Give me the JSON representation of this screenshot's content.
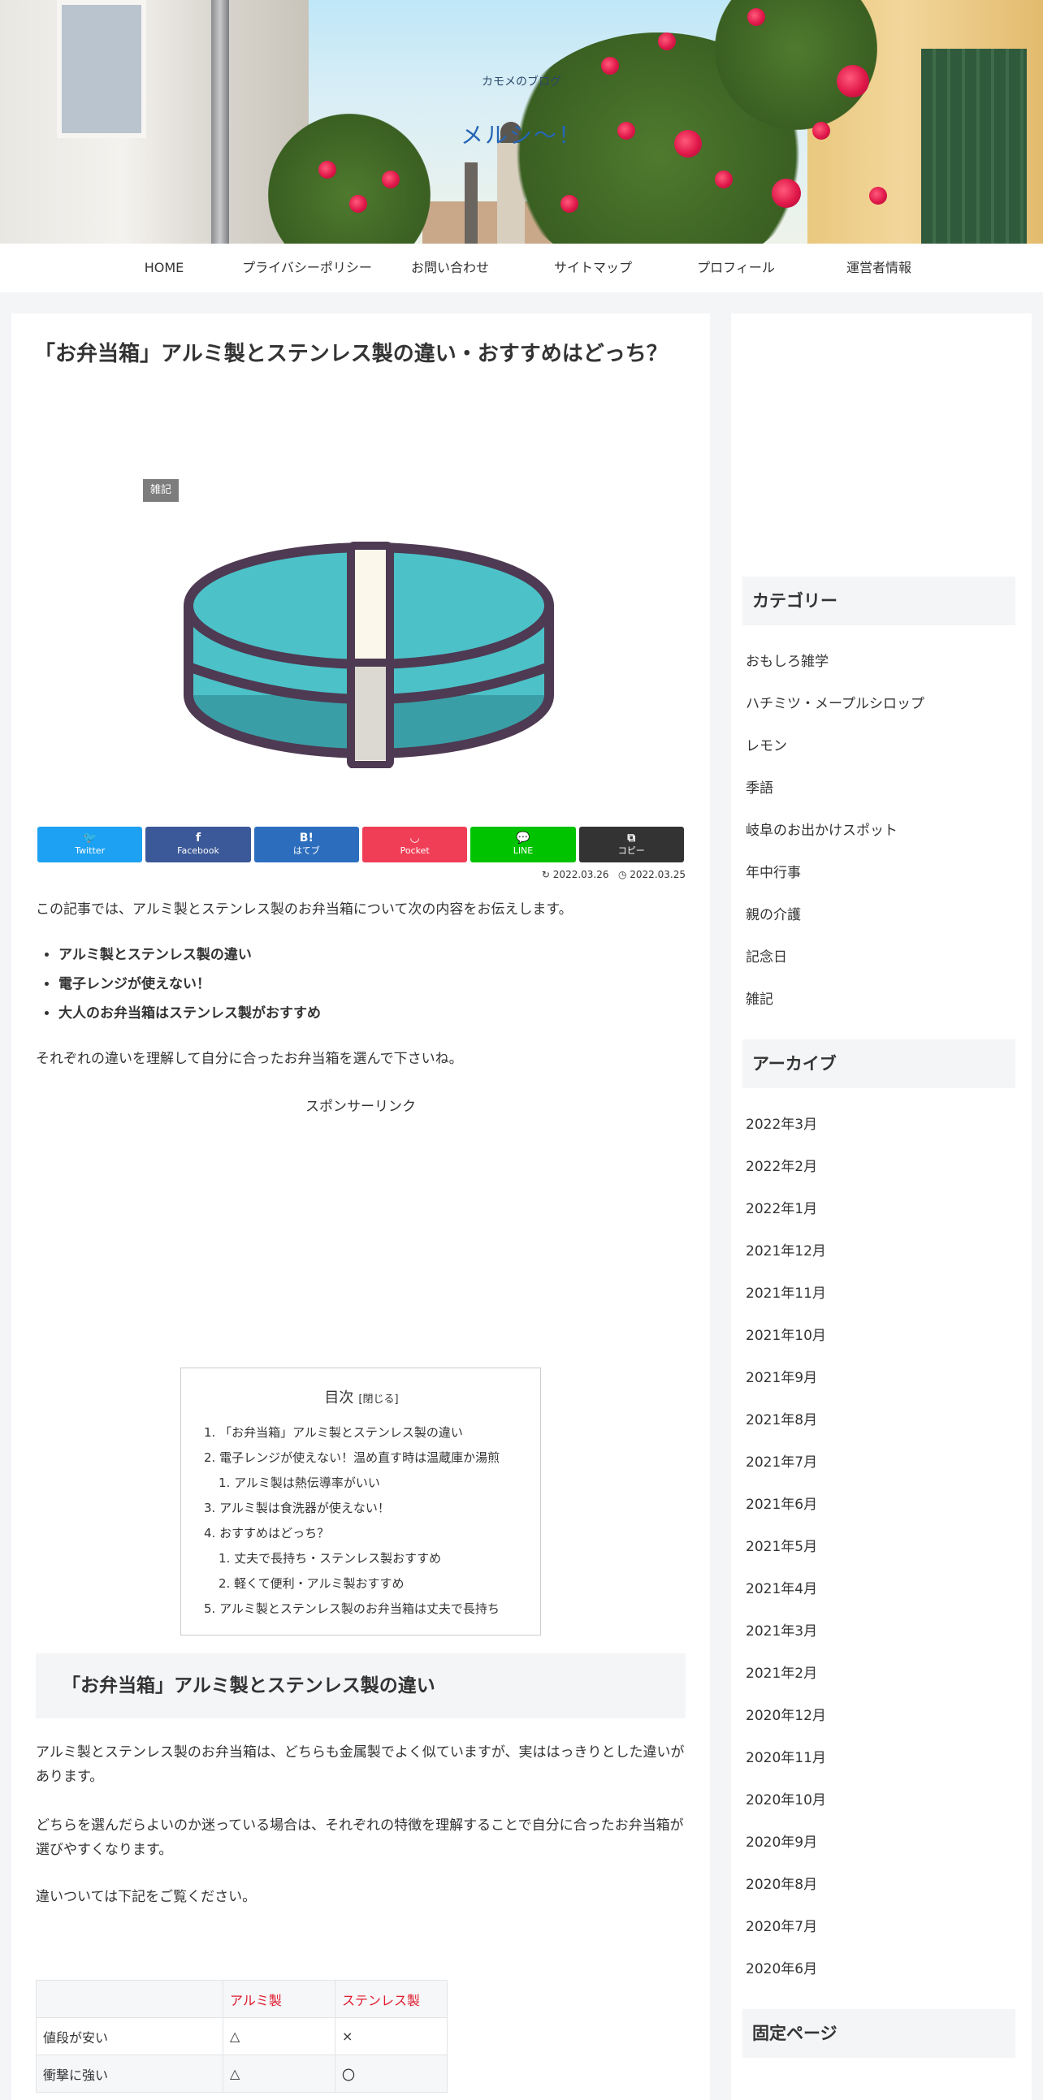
{
  "site": {
    "tagline": "カモメのブログ",
    "title": "メルシ～！"
  },
  "nav": [
    "HOME",
    "プライバシーポリシー",
    "お問い合わせ",
    "サイトマップ",
    "プロフィール",
    "運営者情報"
  ],
  "article": {
    "title": "「お弁当箱」アルミ製とステンレス製の違い・おすすめはどっち？",
    "category": "雑記",
    "share": [
      {
        "icon": "twitter-icon",
        "glyph": "🐦",
        "label": "Twitter",
        "color": "#1da1f2"
      },
      {
        "icon": "facebook-icon",
        "glyph": "f",
        "label": "Facebook",
        "color": "#3b5998"
      },
      {
        "icon": "hatena-icon",
        "glyph": "B!",
        "label": "はてブ",
        "color": "#2c6ebd"
      },
      {
        "icon": "pocket-icon",
        "glyph": "◡",
        "label": "Pocket",
        "color": "#ef3e56"
      },
      {
        "icon": "line-icon",
        "glyph": "💬",
        "label": "LINE",
        "color": "#00c300"
      },
      {
        "icon": "copy-icon",
        "glyph": "⧉",
        "label": "コピー",
        "color": "#333333"
      }
    ],
    "updated": "2022.03.26",
    "published": "2022.03.25",
    "intro": "この記事では、アルミ製とステンレス製のお弁当箱について次の内容をお伝えします。",
    "bullets": [
      "アルミ製とステンレス製の違い",
      "電子レンジが使えない！",
      "大人のお弁当箱はステンレス製がおすすめ"
    ],
    "lead": "それぞれの違いを理解して自分に合ったお弁当箱を選んで下さいね。",
    "sponsor": "スポンサーリンク",
    "toc": {
      "title": "目次",
      "toggle": "[閉じる]",
      "items": [
        "1. 「お弁当箱」アルミ製とステンレス製の違い",
        "2. 電子レンジが使えない！温め直す時は温蔵庫か湯煎",
        "1. アルミ製は熱伝導率がいい",
        "3. アルミ製は食洗器が使えない！",
        "4. おすすめはどっち？",
        "1. 丈夫で長持ち・ステンレス製おすすめ",
        "2. 軽くて便利・アルミ製おすすめ",
        "5. アルミ製とステンレス製のお弁当箱は丈夫で長持ち"
      ]
    },
    "h2": "「お弁当箱」アルミ製とステンレス製の違い",
    "p1": "アルミ製とステンレス製のお弁当箱は、どちらも金属製でよく似ていますが、実ははっきりとした違いがあります。",
    "p2": "どちらを選んだらよいのか迷っている場合は、それぞれの特徴を理解することで自分に合ったお弁当箱が選びやすくなります。",
    "p3": "違いついては下記をご覧ください。",
    "table": {
      "headers": [
        "",
        "アルミ製",
        "ステンレス製"
      ],
      "rows": [
        [
          "値段が安い",
          "△",
          "×"
        ],
        [
          "衝撃に強い",
          "△",
          "〇"
        ]
      ]
    }
  },
  "sidebar": {
    "categories_title": "カテゴリー",
    "categories": [
      "おもしろ雑学",
      "ハチミツ・メープルシロップ",
      "レモン",
      "季語",
      "岐阜のお出かけスポット",
      "年中行事",
      "親の介護",
      "記念日",
      "雑記"
    ],
    "archive_title": "アーカイブ",
    "archives": [
      "2022年3月",
      "2022年2月",
      "2022年1月",
      "2021年12月",
      "2021年11月",
      "2021年10月",
      "2021年9月",
      "2021年8月",
      "2021年7月",
      "2021年6月",
      "2021年5月",
      "2021年4月",
      "2021年3月",
      "2021年2月",
      "2020年12月",
      "2020年11月",
      "2020年10月",
      "2020年9月",
      "2020年8月",
      "2020年7月",
      "2020年6月"
    ],
    "fixed_title": "固定ページ"
  }
}
